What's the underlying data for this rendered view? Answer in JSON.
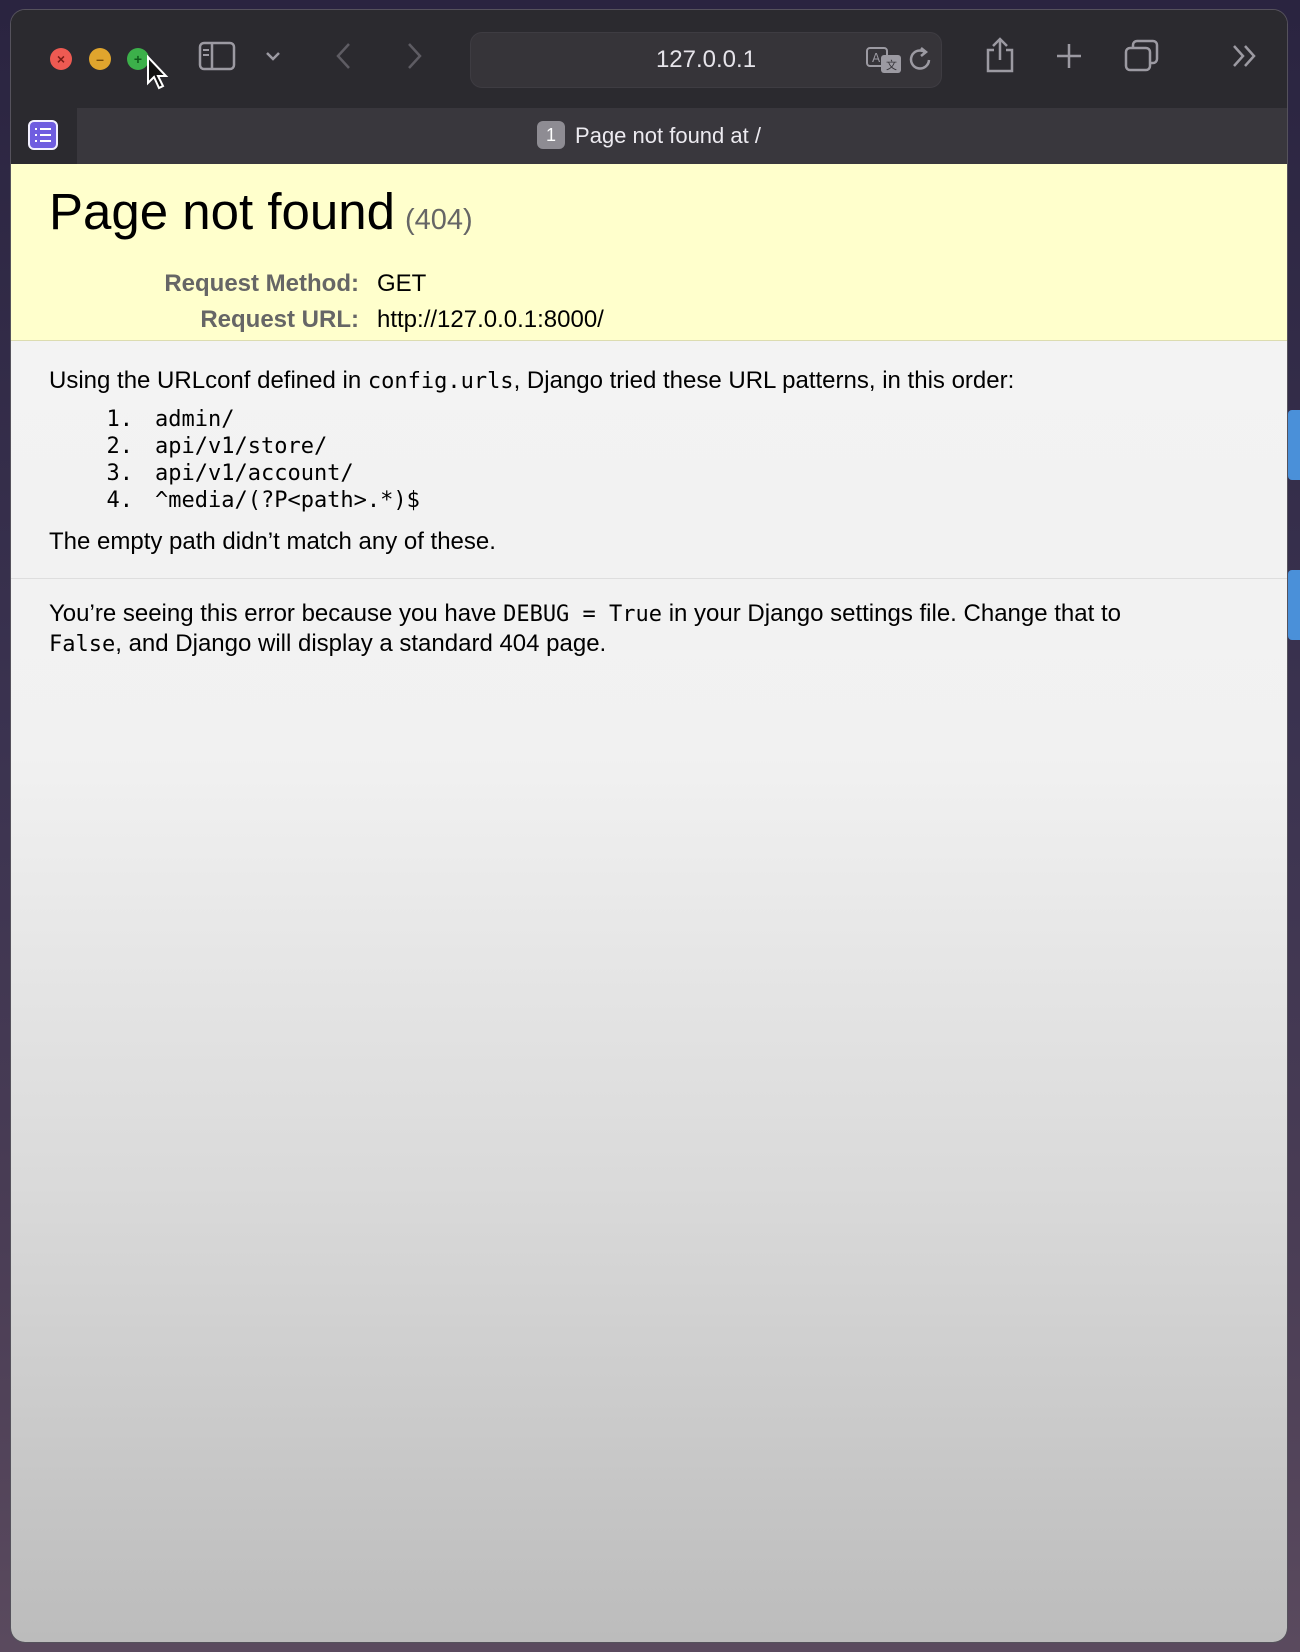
{
  "browser": {
    "address": "127.0.0.1",
    "tab_count": "1",
    "tab_title": "Page not found at /"
  },
  "page": {
    "title": "Page not found",
    "status_code": "(404)",
    "request_method_label": "Request Method:",
    "request_method": "GET",
    "request_url_label": "Request URL:",
    "request_url": "http://127.0.0.1:8000/",
    "urlconf_intro_before": "Using the URLconf defined in ",
    "urlconf_module": "config.urls",
    "urlconf_intro_after": ", Django tried these URL patterns, in this order:",
    "patterns": [
      {
        "num": "1.",
        "pattern": "admin/"
      },
      {
        "num": "2.",
        "pattern": "api/v1/store/"
      },
      {
        "num": "3.",
        "pattern": "api/v1/account/"
      },
      {
        "num": "4.",
        "pattern": "^media/(?P<path>.*)$"
      }
    ],
    "no_match": "The empty path didn’t match any of these.",
    "explanation_1": "You’re seeing this error because you have ",
    "debug_code": "DEBUG = True",
    "explanation_2": " in your Django settings file. Change that to",
    "false_code": "False",
    "explanation_3": ", and Django will display a standard 404 page."
  },
  "colors": {
    "summary_bg": "#ffffcc",
    "close": "#ee5a52",
    "minimize": "#e0a52d",
    "maximize": "#3cb04a",
    "sidebar_accent": "#6f5de0"
  },
  "icons": [
    "close-icon",
    "minimize-icon",
    "maximize-icon",
    "sidebar-toggle-icon",
    "chevron-down-icon",
    "back-icon",
    "forward-icon",
    "translate-icon",
    "reload-icon",
    "share-icon",
    "new-tab-icon",
    "tab-overview-icon",
    "more-icon",
    "sidebar-list-icon"
  ]
}
